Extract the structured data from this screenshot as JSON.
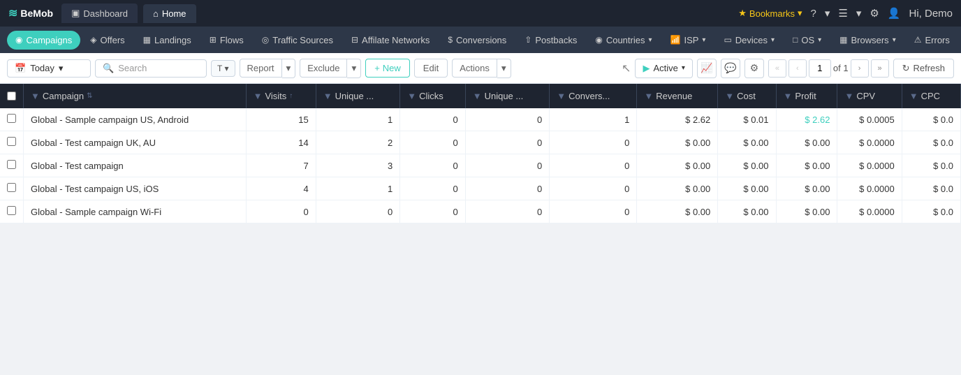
{
  "app": {
    "logo_text": "BeMob",
    "logo_icon": "≋"
  },
  "tabs": [
    {
      "id": "dashboard",
      "label": "Dashboard",
      "icon": "▣",
      "active": false
    },
    {
      "id": "home",
      "label": "Home",
      "icon": "⌂",
      "active": true
    }
  ],
  "top_right": {
    "bookmarks_label": "Bookmarks",
    "help_icon": "?",
    "notification_icon": "☰",
    "settings_icon": "⚙",
    "user_label": "Hi, Demo"
  },
  "nav": {
    "items": [
      {
        "id": "campaigns",
        "label": "Campaigns",
        "icon": "◉",
        "active": true
      },
      {
        "id": "offers",
        "label": "Offers",
        "icon": "◈"
      },
      {
        "id": "landings",
        "label": "Landings",
        "icon": "▦"
      },
      {
        "id": "flows",
        "label": "Flows",
        "icon": "⊞"
      },
      {
        "id": "traffic-sources",
        "label": "Traffic Sources",
        "icon": "◎"
      },
      {
        "id": "affiliate-networks",
        "label": "Affilate Networks",
        "icon": "⊟"
      },
      {
        "id": "conversions",
        "label": "Conversions",
        "icon": "$"
      },
      {
        "id": "postbacks",
        "label": "Postbacks",
        "icon": "⇧"
      },
      {
        "id": "countries",
        "label": "Countries",
        "icon": "◉"
      },
      {
        "id": "isp",
        "label": "ISP",
        "icon": "📶"
      },
      {
        "id": "devices",
        "label": "Devices",
        "icon": "▭"
      },
      {
        "id": "os",
        "label": "OS",
        "icon": "□"
      },
      {
        "id": "browsers",
        "label": "Browsers",
        "icon": "▦"
      },
      {
        "id": "errors",
        "label": "Errors",
        "icon": "⚠"
      }
    ]
  },
  "toolbar": {
    "date_label": "Today",
    "date_icon": "📅",
    "search_placeholder": "Search",
    "filter_icon": "T",
    "report_label": "Report",
    "exclude_label": "Exclude",
    "new_label": "+ New",
    "edit_label": "Edit",
    "actions_label": "Actions",
    "active_label": "Active",
    "page_current": "1",
    "page_of": "of 1",
    "refresh_label": "Refresh",
    "cursor_icon": "↖"
  },
  "table": {
    "columns": [
      {
        "id": "campaign",
        "label": "Campaign"
      },
      {
        "id": "visits",
        "label": "Visits"
      },
      {
        "id": "unique1",
        "label": "Unique ..."
      },
      {
        "id": "clicks",
        "label": "Clicks"
      },
      {
        "id": "unique2",
        "label": "Unique ..."
      },
      {
        "id": "conversions",
        "label": "Convers..."
      },
      {
        "id": "revenue",
        "label": "Revenue"
      },
      {
        "id": "cost",
        "label": "Cost"
      },
      {
        "id": "profit",
        "label": "Profit"
      },
      {
        "id": "cpv",
        "label": "CPV"
      },
      {
        "id": "cpc",
        "label": "CPC"
      }
    ],
    "rows": [
      {
        "campaign": "Global - Sample campaign US, Android",
        "visits": "15",
        "unique1": "1",
        "clicks": "0",
        "unique2": "0",
        "conversions": "1",
        "revenue": "$ 2.62",
        "cost": "$ 0.01",
        "profit": "$ 2.62",
        "cpv": "$ 0.0005",
        "cpc": "$ 0.0",
        "profit_highlight": true
      },
      {
        "campaign": "Global - Test campaign UK, AU",
        "visits": "14",
        "unique1": "2",
        "clicks": "0",
        "unique2": "0",
        "conversions": "0",
        "revenue": "$ 0.00",
        "cost": "$ 0.00",
        "profit": "$ 0.00",
        "cpv": "$ 0.0000",
        "cpc": "$ 0.0",
        "profit_highlight": false
      },
      {
        "campaign": "Global - Test campaign",
        "visits": "7",
        "unique1": "3",
        "clicks": "0",
        "unique2": "0",
        "conversions": "0",
        "revenue": "$ 0.00",
        "cost": "$ 0.00",
        "profit": "$ 0.00",
        "cpv": "$ 0.0000",
        "cpc": "$ 0.0",
        "profit_highlight": false
      },
      {
        "campaign": "Global - Test campaign US, iOS",
        "visits": "4",
        "unique1": "1",
        "clicks": "0",
        "unique2": "0",
        "conversions": "0",
        "revenue": "$ 0.00",
        "cost": "$ 0.00",
        "profit": "$ 0.00",
        "cpv": "$ 0.0000",
        "cpc": "$ 0.0",
        "profit_highlight": false
      },
      {
        "campaign": "Global - Sample campaign Wi-Fi",
        "visits": "0",
        "unique1": "0",
        "clicks": "0",
        "unique2": "0",
        "conversions": "0",
        "revenue": "$ 0.00",
        "cost": "$ 0.00",
        "profit": "$ 0.00",
        "cpv": "$ 0.0000",
        "cpc": "$ 0.0",
        "profit_highlight": false
      }
    ]
  },
  "colors": {
    "header_bg": "#1e2430",
    "nav_bg": "#2d3748",
    "accent": "#3ecfbe",
    "profit_color": "#3ecfbe"
  }
}
